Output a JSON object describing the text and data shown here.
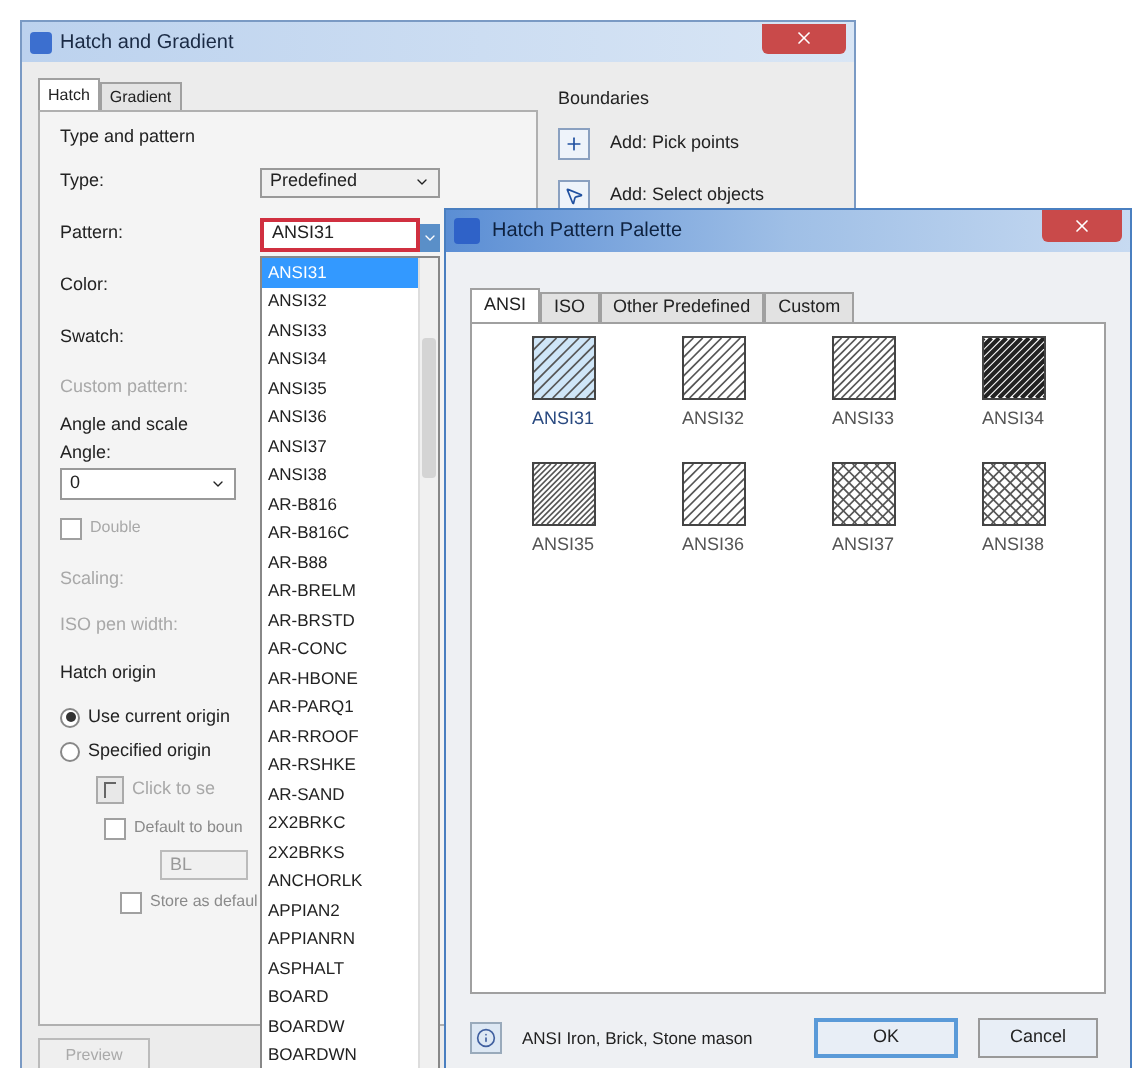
{
  "main_dialog": {
    "title": "Hatch and Gradient",
    "tabs": [
      {
        "label": "Hatch",
        "selected": true
      },
      {
        "label": "Gradient",
        "selected": false
      }
    ],
    "type_and_pattern": {
      "heading": "Type and pattern",
      "type_label": "Type:",
      "type_value": "Predefined",
      "pattern_label": "Pattern:",
      "pattern_value": "ANSI31",
      "color_label": "Color:",
      "swatch_label": "Swatch:",
      "custom_pattern_label": "Custom pattern:"
    },
    "angle_and_scale": {
      "heading": "Angle and scale",
      "angle_label": "Angle:",
      "angle_value": "0",
      "double": {
        "label": "Double",
        "checked": false,
        "disabled": true
      },
      "scaling_label": "Scaling:",
      "iso_pen_label": "ISO pen width:"
    },
    "hatch_origin": {
      "heading": "Hatch origin",
      "options": [
        {
          "label": "Use current origin",
          "selected": true
        },
        {
          "label": "Specified origin",
          "selected": false
        }
      ],
      "click_label": "Click to se",
      "default_to_boundary": {
        "label": "Default to boun",
        "checked": false
      },
      "position_value": "BL",
      "store_default": {
        "label": "Store as defaul",
        "checked": false
      }
    },
    "preview_button": "Preview",
    "boundaries": {
      "heading": "Boundaries",
      "buttons": [
        "Add: Pick points",
        "Add: Select objects"
      ]
    },
    "pattern_list": [
      {
        "label": "ANSI31",
        "selected": true
      },
      {
        "label": "ANSI32",
        "selected": false
      },
      {
        "label": "ANSI33",
        "selected": false
      },
      {
        "label": "ANSI34",
        "selected": false
      },
      {
        "label": "ANSI35",
        "selected": false
      },
      {
        "label": "ANSI36",
        "selected": false
      },
      {
        "label": "ANSI37",
        "selected": false
      },
      {
        "label": "ANSI38",
        "selected": false
      },
      {
        "label": "AR-B816",
        "selected": false
      },
      {
        "label": "AR-B816C",
        "selected": false
      },
      {
        "label": "AR-B88",
        "selected": false
      },
      {
        "label": "AR-BRELM",
        "selected": false
      },
      {
        "label": "AR-BRSTD",
        "selected": false
      },
      {
        "label": "AR-CONC",
        "selected": false
      },
      {
        "label": "AR-HBONE",
        "selected": false
      },
      {
        "label": "AR-PARQ1",
        "selected": false
      },
      {
        "label": "AR-RROOF",
        "selected": false
      },
      {
        "label": "AR-RSHKE",
        "selected": false
      },
      {
        "label": "AR-SAND",
        "selected": false
      },
      {
        "label": "2X2BRKC",
        "selected": false
      },
      {
        "label": "2X2BRKS",
        "selected": false
      },
      {
        "label": "ANCHORLK",
        "selected": false
      },
      {
        "label": "APPIAN2",
        "selected": false
      },
      {
        "label": "APPIANRN",
        "selected": false
      },
      {
        "label": "ASPHALT",
        "selected": false
      },
      {
        "label": "BOARD",
        "selected": false
      },
      {
        "label": "BOARDW",
        "selected": false
      },
      {
        "label": "BOARDWN",
        "selected": false
      }
    ]
  },
  "palette": {
    "title": "Hatch Pattern Palette",
    "tabs": [
      {
        "label": "ANSI",
        "selected": true
      },
      {
        "label": "ISO",
        "selected": false
      },
      {
        "label": "Other Predefined",
        "selected": false
      },
      {
        "label": "Custom",
        "selected": false
      }
    ],
    "patterns": [
      {
        "label": "ANSI31",
        "selected": true
      },
      {
        "label": "ANSI32",
        "selected": false
      },
      {
        "label": "ANSI33",
        "selected": false
      },
      {
        "label": "ANSI34",
        "selected": false
      },
      {
        "label": "ANSI35",
        "selected": false
      },
      {
        "label": "ANSI36",
        "selected": false
      },
      {
        "label": "ANSI37",
        "selected": false
      },
      {
        "label": "ANSI38",
        "selected": false
      }
    ],
    "description": "ANSI Iron, Brick, Stone mason",
    "buttons": [
      {
        "label": "OK",
        "default": true
      },
      {
        "label": "Cancel",
        "default": false
      }
    ]
  }
}
